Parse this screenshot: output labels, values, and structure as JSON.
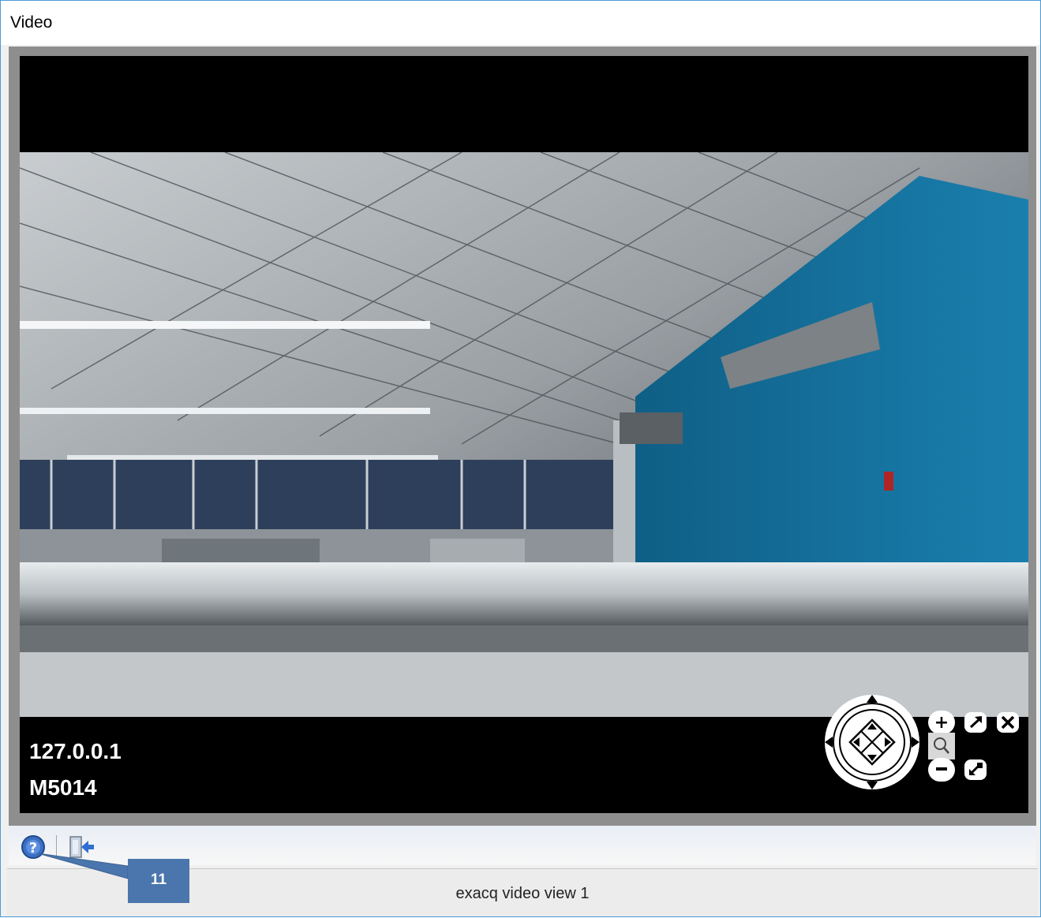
{
  "window": {
    "title": "Video"
  },
  "video": {
    "overlay_line1": "127.0.0.1",
    "overlay_line2": "M5014"
  },
  "ptz_controls": {
    "icons": [
      "pan-tilt-pad-icon",
      "zoom-in-icon",
      "zoom-magnifier-icon",
      "zoom-out-icon",
      "maximize-icon",
      "close-icon",
      "restore-icon"
    ]
  },
  "toolbar": {
    "icons": [
      "help-icon",
      "exit-icon"
    ]
  },
  "status_bar": {
    "text": "exacq video view 1"
  },
  "callout": {
    "label": "11",
    "color": "#4a76ad"
  }
}
